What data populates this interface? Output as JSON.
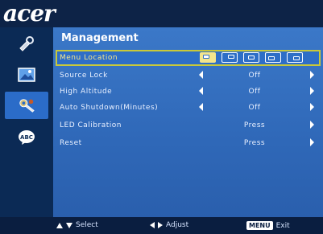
{
  "brand": {
    "logo_text": "acer"
  },
  "sidebar": {
    "items": [
      {
        "icon": "tools-icon",
        "active": false
      },
      {
        "icon": "picture-icon",
        "active": false
      },
      {
        "icon": "settings-wrench-icon",
        "active": true
      },
      {
        "icon": "language-abc-icon",
        "active": false,
        "label": "ABC"
      }
    ]
  },
  "panel": {
    "title": "Management",
    "rows": [
      {
        "label": "Menu Location",
        "type": "location",
        "selected": true,
        "selected_index": 0
      },
      {
        "label": "Source Lock",
        "value": "Off",
        "has_left": true,
        "has_right": true
      },
      {
        "label": "High Altitude",
        "value": "Off",
        "has_left": true,
        "has_right": true
      },
      {
        "label": "Auto Shutdown(Minutes)",
        "value": "Off",
        "has_left": true,
        "has_right": true
      },
      {
        "label": "LED Calibration",
        "value": "Press",
        "has_left": false,
        "has_right": true
      },
      {
        "label": "Reset",
        "value": "Press",
        "has_left": false,
        "has_right": true
      }
    ]
  },
  "footer": {
    "select_label": "Select",
    "adjust_label": "Adjust",
    "menu_key": "MENU",
    "exit_label": "Exit"
  },
  "colors": {
    "panel": "#3a76c6",
    "sidebar": "#0b2a55",
    "highlight_border": "#c8c83a",
    "highlight_text": "#f3e58c"
  }
}
